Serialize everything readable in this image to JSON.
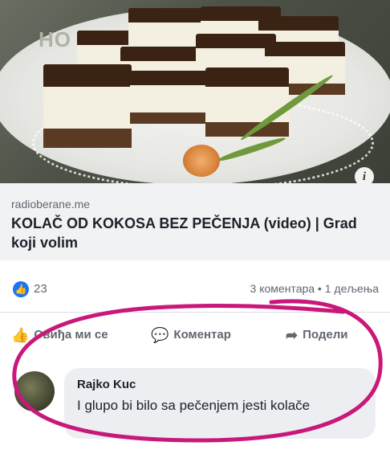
{
  "link_preview": {
    "image_alt": "coconut no-bake cake squares on a plate",
    "info_icon": "i",
    "domain": "radioberane.me",
    "headline": "KOLAČ OD KOKOSA BEZ PEČENJA (video) | Grad koji volim"
  },
  "stats": {
    "like_icon": "like-icon",
    "like_count": "23",
    "comments_shares": "3 коментара • 1 дељења"
  },
  "actions": {
    "like_label": "Свиђа ми се",
    "comment_label": "Коментар",
    "share_label": "Подели"
  },
  "comment": {
    "author": "Rajko Kuc",
    "text": "I glupo bi bilo sa pečenjem jesti kolače"
  },
  "colors": {
    "like_blue": "#1877f2",
    "annotation_magenta": "#c8187a"
  }
}
